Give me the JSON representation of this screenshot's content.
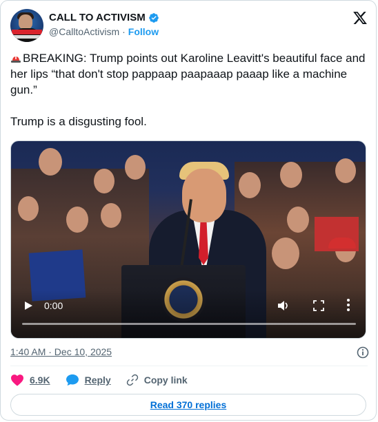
{
  "author": {
    "display_name": "CALL TO ACTIVISM",
    "handle": "@CalltoActivism",
    "separator": "·",
    "follow_label": "Follow",
    "verified": true,
    "avatar_icon": "activist-avatar"
  },
  "platform": {
    "logo_icon": "x-logo-icon"
  },
  "tweet": {
    "siren_icon": "rotating-light-emoji",
    "text": "BREAKING: Trump points out Karoline Leavitt's beautiful face and her lips “that don't stop pappaap paapaaap paaap like a machine gun.”\n\nTrump is a disgusting fool."
  },
  "video": {
    "current_time": "0:00",
    "progress": 0,
    "controls": [
      "play-icon",
      "volume-icon",
      "fullscreen-icon",
      "more-icon"
    ]
  },
  "meta": {
    "timestamp": "1:40 AM · Dec 10, 2025",
    "info_icon": "info-icon"
  },
  "actions": {
    "like_count": "6.9K",
    "reply_label": "Reply",
    "copy_label": "Copy link"
  },
  "replies": {
    "label": "Read 370 replies"
  },
  "colors": {
    "accent": "#1d9bf0",
    "like": "#f91880",
    "text": "#0f1419",
    "muted": "#536471",
    "link": "#006fd6"
  }
}
